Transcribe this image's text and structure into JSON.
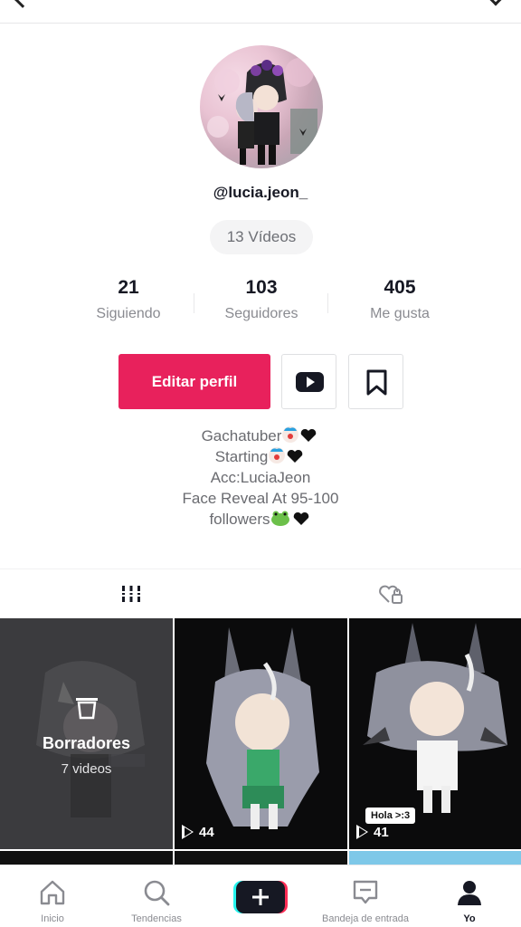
{
  "profile": {
    "username": "@lucia.jeon_",
    "videos_label": "13 Vídeos"
  },
  "stats": {
    "following": {
      "value": "21",
      "label": "Siguiendo"
    },
    "followers": {
      "value": "103",
      "label": "Seguidores"
    },
    "likes": {
      "value": "405",
      "label": "Me gusta"
    }
  },
  "actions": {
    "edit_profile": "Editar perfil",
    "youtube_icon": "youtube-icon",
    "bookmark_icon": "bookmark-icon"
  },
  "bio": {
    "line1": "Gachatuber",
    "line2": "Starting",
    "line3": "Acc:LuciaJeon",
    "line4": "Face Reveal At 95-100",
    "line5": "followers"
  },
  "tabs": {
    "videos_icon": "grid-icon",
    "liked_icon": "locked-heart-icon"
  },
  "grid": {
    "drafts": {
      "title": "Borradores",
      "count": "7 videos"
    },
    "video2": {
      "plays": "44"
    },
    "video3": {
      "plays": "41",
      "sticker": "Hola >:3"
    }
  },
  "nav": {
    "home": "Inicio",
    "trending": "Tendencias",
    "create_icon": "plus-icon",
    "inbox": "Bandeja de entrada",
    "me": "Yo"
  },
  "colors": {
    "accent": "#e8215c",
    "text": "#161823",
    "muted": "#8a8b91"
  }
}
